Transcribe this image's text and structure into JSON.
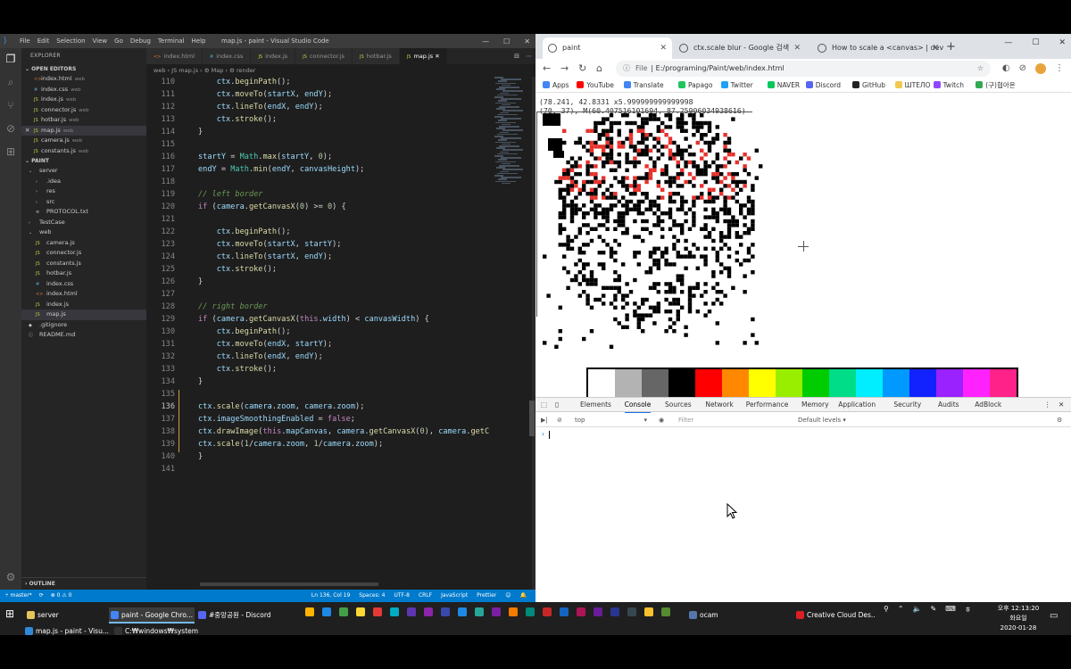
{
  "vscode": {
    "menu": [
      "File",
      "Edit",
      "Selection",
      "View",
      "Go",
      "Debug",
      "Terminal",
      "Help"
    ],
    "window_title": "map.js - paint - Visual Studio Code",
    "explorer_header": "EXPLORER",
    "open_editors_label": "OPEN EDITORS",
    "open_editors": [
      {
        "name": "index.html",
        "sub": "web",
        "type": "html"
      },
      {
        "name": "index.css",
        "sub": "web",
        "type": "css"
      },
      {
        "name": "index.js",
        "sub": "web",
        "type": "js"
      },
      {
        "name": "connector.js",
        "sub": "web",
        "type": "js"
      },
      {
        "name": "hotbar.js",
        "sub": "web",
        "type": "js"
      },
      {
        "name": "map.js",
        "sub": "web",
        "type": "js",
        "selected": true
      },
      {
        "name": "camera.js",
        "sub": "web",
        "type": "js"
      },
      {
        "name": "constants.js",
        "sub": "web",
        "type": "js"
      }
    ],
    "project_label": "PAINT",
    "tree": [
      {
        "name": "server",
        "indent": 1,
        "arrow": "⌄"
      },
      {
        "name": ".idea",
        "indent": 2,
        "arrow": "›"
      },
      {
        "name": "res",
        "indent": 2,
        "arrow": "›"
      },
      {
        "name": "src",
        "indent": 2,
        "arrow": "›"
      },
      {
        "name": "PROTOCOL.txt",
        "indent": 2,
        "arrow": "≡"
      },
      {
        "name": "TestCase",
        "indent": 1,
        "arrow": "›"
      },
      {
        "name": "web",
        "indent": 1,
        "arrow": "⌄"
      },
      {
        "name": "camera.js",
        "indent": 2,
        "arrow": "JS"
      },
      {
        "name": "connector.js",
        "indent": 2,
        "arrow": "JS"
      },
      {
        "name": "constants.js",
        "indent": 2,
        "arrow": "JS"
      },
      {
        "name": "hotbar.js",
        "indent": 2,
        "arrow": "JS"
      },
      {
        "name": "index.css",
        "indent": 2,
        "arrow": "#"
      },
      {
        "name": "index.html",
        "indent": 2,
        "arrow": "<>"
      },
      {
        "name": "index.js",
        "indent": 2,
        "arrow": "JS"
      },
      {
        "name": "map.js",
        "indent": 2,
        "arrow": "JS",
        "selected": true
      },
      {
        "name": ".gitignore",
        "indent": 1,
        "arrow": "◆"
      },
      {
        "name": "README.md",
        "indent": 1,
        "arrow": "ⓘ"
      }
    ],
    "outline_label": "OUTLINE",
    "tabs": [
      {
        "name": "index.html",
        "type": "html"
      },
      {
        "name": "index.css",
        "type": "css"
      },
      {
        "name": "index.js",
        "type": "js"
      },
      {
        "name": "connector.js",
        "type": "js"
      },
      {
        "name": "hotbar.js",
        "type": "js"
      },
      {
        "name": "map.js",
        "type": "js",
        "active": true
      }
    ],
    "breadcrumb": "web › JS map.js › ⚙ Map › ⚙ render",
    "code_lines": [
      {
        "n": "110",
        "html": "    <span class='v'>ctx</span>.<span class='f'>beginPath</span>();"
      },
      {
        "n": "111",
        "html": "    <span class='v'>ctx</span>.<span class='f'>moveTo</span>(<span class='v'>startX</span>, <span class='v'>endY</span>);"
      },
      {
        "n": "112",
        "html": "    <span class='v'>ctx</span>.<span class='f'>lineTo</span>(<span class='v'>endX</span>, <span class='v'>endY</span>);"
      },
      {
        "n": "113",
        "html": "    <span class='v'>ctx</span>.<span class='f'>stroke</span>();"
      },
      {
        "n": "114",
        "html": "}"
      },
      {
        "n": "115",
        "html": ""
      },
      {
        "n": "116",
        "html": "<span class='v'>startY</span> = <span class='t'>Math</span>.<span class='f'>max</span>(<span class='v'>startY</span>, <span class='n'>0</span>);"
      },
      {
        "n": "117",
        "html": "<span class='v'>endY</span> = <span class='t'>Math</span>.<span class='f'>min</span>(<span class='v'>endY</span>, <span class='v'>canvasHeight</span>);"
      },
      {
        "n": "118",
        "html": ""
      },
      {
        "n": "119",
        "html": "<span class='c'>// left border</span>"
      },
      {
        "n": "120",
        "html": "<span class='k'>if</span> (<span class='v'>camera</span>.<span class='f'>getCanvasX</span>(<span class='n'>0</span>) &gt;= <span class='n'>0</span>) {"
      },
      {
        "n": "121",
        "html": ""
      },
      {
        "n": "122",
        "html": "    <span class='v'>ctx</span>.<span class='f'>beginPath</span>();"
      },
      {
        "n": "123",
        "html": "    <span class='v'>ctx</span>.<span class='f'>moveTo</span>(<span class='v'>startX</span>, <span class='v'>startY</span>);"
      },
      {
        "n": "124",
        "html": "    <span class='v'>ctx</span>.<span class='f'>lineTo</span>(<span class='v'>startX</span>, <span class='v'>endY</span>);"
      },
      {
        "n": "125",
        "html": "    <span class='v'>ctx</span>.<span class='f'>stroke</span>();"
      },
      {
        "n": "126",
        "html": "}"
      },
      {
        "n": "127",
        "html": ""
      },
      {
        "n": "128",
        "html": "<span class='c'>// right border</span>"
      },
      {
        "n": "129",
        "html": "<span class='k'>if</span> (<span class='v'>camera</span>.<span class='f'>getCanvasX</span>(<span class='k'>this</span>.<span class='v'>width</span>) &lt; <span class='v'>canvasWidth</span>) {"
      },
      {
        "n": "130",
        "html": "    <span class='v'>ctx</span>.<span class='f'>beginPath</span>();"
      },
      {
        "n": "131",
        "html": "    <span class='v'>ctx</span>.<span class='f'>moveTo</span>(<span class='v'>endX</span>, <span class='v'>startY</span>);"
      },
      {
        "n": "132",
        "html": "    <span class='v'>ctx</span>.<span class='f'>lineTo</span>(<span class='v'>endX</span>, <span class='v'>endY</span>);"
      },
      {
        "n": "133",
        "html": "    <span class='v'>ctx</span>.<span class='f'>stroke</span>();"
      },
      {
        "n": "134",
        "html": "}"
      },
      {
        "n": "135",
        "html": ""
      },
      {
        "n": "136",
        "html": "<span class='v'>ctx</span>.<span class='f'>scale</span>(<span class='v'>camera</span>.<span class='v'>zoom</span>, <span class='v'>camera</span>.<span class='v'>zoom</span>);",
        "current": true
      },
      {
        "n": "137",
        "html": "<span class='v'>ctx</span>.<span class='v'>imageSmoothingEnabled</span> = <span class='k'>false</span>;"
      },
      {
        "n": "138",
        "html": "<span class='v'>ctx</span>.<span class='f'>drawImage</span>(<span class='k'>this</span>.<span class='v'>mapCanvas</span>, <span class='v'>camera</span>.<span class='f'>getCanvasX</span>(<span class='n'>0</span>), <span class='v'>camera</span>.<span class='f'>getC</span>"
      },
      {
        "n": "139",
        "html": "<span class='v'>ctx</span>.<span class='f'>scale</span>(<span class='n'>1</span>/<span class='v'>camera</span>.<span class='v'>zoom</span>, <span class='n'>1</span>/<span class='v'>camera</span>.<span class='v'>zoom</span>);"
      },
      {
        "n": "140",
        "html": "}"
      },
      {
        "n": "141",
        "html": ""
      }
    ],
    "status": {
      "branch": "master*",
      "sync": "⟳",
      "problems": "⊗ 0 ⚠ 0",
      "position": "Ln 136, Col 19",
      "spaces": "Spaces: 4",
      "encoding": "UTF-8",
      "eol": "CRLF",
      "language": "JavaScript",
      "formatter": "Prettier",
      "feedback": "☺",
      "bell": "🔔"
    }
  },
  "chrome": {
    "tabs": [
      {
        "title": "paint",
        "active": true
      },
      {
        "title": "ctx.scale blur - Google 검색"
      },
      {
        "title": "How to scale a <canvas> | devi..."
      }
    ],
    "url_prefix": "File",
    "url": "E:/programing/Paint/web/index.html",
    "bookmarks": [
      {
        "label": "Apps",
        "color": "#4285f4"
      },
      {
        "label": "YouTube",
        "color": "#ff0000"
      },
      {
        "label": "Translate",
        "color": "#4285f4"
      },
      {
        "label": "Papago",
        "color": "#21c55d"
      },
      {
        "label": "Twitter",
        "color": "#1da1f2"
      },
      {
        "label": "NAVER",
        "color": "#03c75a"
      },
      {
        "label": "Discord",
        "color": "#5865f2"
      },
      {
        "label": "GitHub",
        "color": "#222222"
      },
      {
        "label": "ШТЕЛО",
        "color": "#f2c94c"
      },
      {
        "label": "Twitch",
        "color": "#9146ff"
      },
      {
        "label": "(구)협아온",
        "color": "#34a853"
      }
    ],
    "coords_line1": "(78.241, 42.8331 x5.999999999999998",
    "coords_line2": "(70, 37), M(60.407516101694, 87.25906034938616)",
    "palette": [
      "#ffffff",
      "#b3b3b3",
      "#666666",
      "#000000",
      "#ff0000",
      "#ff8800",
      "#ffff00",
      "#99ee00",
      "#00cc00",
      "#00dd88",
      "#00eeff",
      "#0099ff",
      "#1122ff",
      "#9922ff",
      "#ff22ff",
      "#ff2288"
    ],
    "devtools": {
      "tabs": [
        "Elements",
        "Console",
        "Sources",
        "Network",
        "Performance",
        "Memory",
        "Application",
        "Security",
        "Audits",
        "AdBlock"
      ],
      "active_tab": "Console",
      "context": "top",
      "filter_placeholder": "Filter",
      "levels": "Default levels ▾",
      "prompt": "›"
    }
  },
  "taskbar": {
    "buttons": [
      {
        "label": "server",
        "color": "#e8c35a"
      },
      {
        "label": "paint - Google Chro...",
        "color": "#4285f4",
        "active": true
      },
      {
        "label": "#중앙공원 - Discord",
        "color": "#5865f2"
      },
      {
        "label": "ocam",
        "color": "#5577aa"
      },
      {
        "label": "Creative Cloud Des...",
        "color": "#da1f26"
      },
      {
        "label": "map.js - paint - Visu...",
        "color": "#2f88d8"
      },
      {
        "label": "C:₩windows₩system...",
        "color": "#333333"
      }
    ],
    "time": "오후 12:13:20",
    "weekday": "화요일",
    "date": "2020-01-28"
  }
}
